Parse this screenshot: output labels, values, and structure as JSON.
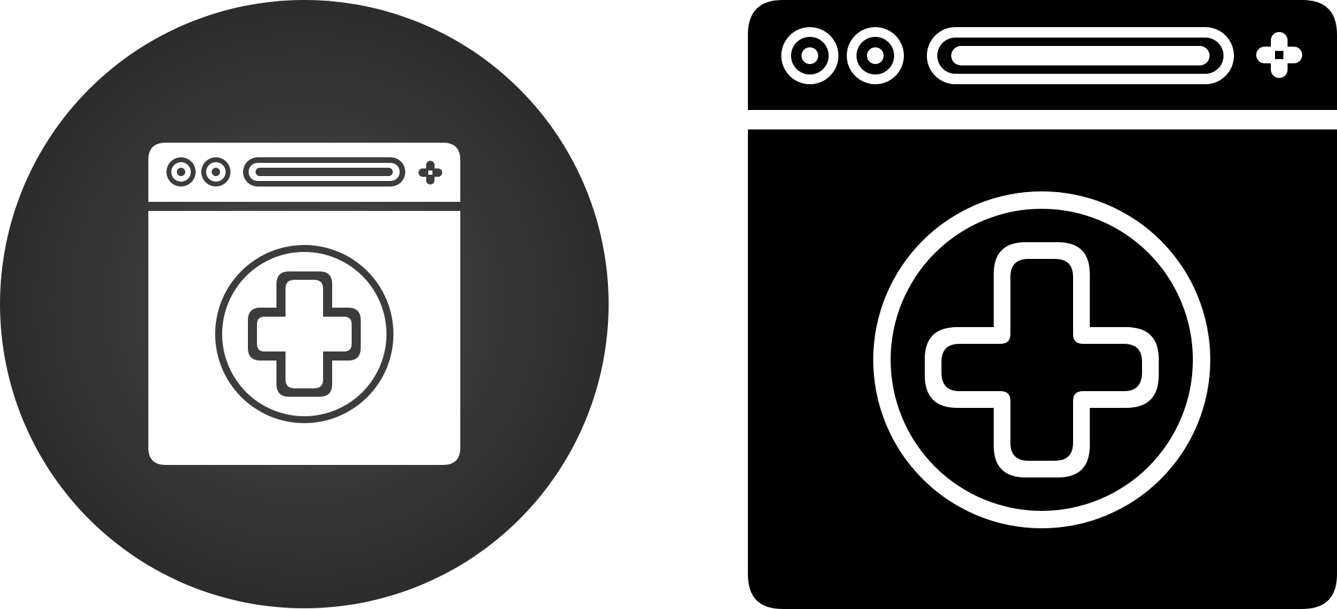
{
  "icons": [
    {
      "name": "medical-website-icon-circle",
      "style": "white glyph on dark gradient circle"
    },
    {
      "name": "medical-website-icon-glyph",
      "style": "solid black glyph"
    }
  ],
  "colors": {
    "background": "#ffffff",
    "circle_light": "#4a4a4a",
    "circle_dark": "#2c2c2c",
    "glyph_white": "#ffffff",
    "glyph_black": "#000000"
  }
}
